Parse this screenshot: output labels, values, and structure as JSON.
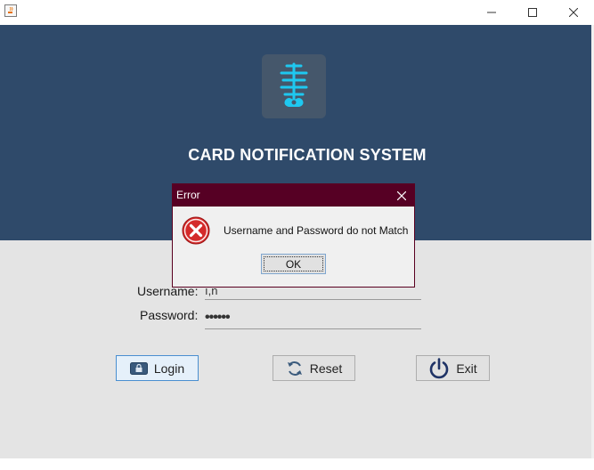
{
  "window": {
    "icon": "java-cup-icon",
    "controls": {
      "minimize": "minimize-icon",
      "maximize": "maximize-icon",
      "close": "close-icon"
    }
  },
  "header": {
    "logo_icon": "card-notification-logo-icon",
    "title": "CARD NOTIFICATION SYSTEM"
  },
  "form": {
    "username_label": "Username:",
    "username_value": "ı,n",
    "password_label": "Password:",
    "password_value": "••••••"
  },
  "buttons": {
    "login": {
      "label": "Login",
      "icon": "lock-icon"
    },
    "reset": {
      "label": "Reset",
      "icon": "refresh-icon"
    },
    "exit": {
      "label": "Exit",
      "icon": "power-icon"
    }
  },
  "dialog": {
    "title": "Error",
    "icon": "error-icon",
    "message": "Username and Password do not Match",
    "ok_label": "OK"
  },
  "colors": {
    "header_bg": "#2f4a6a",
    "dialog_titlebar": "#560024",
    "logo_accent": "#1ec8f0",
    "error_red": "#d42a2a"
  }
}
